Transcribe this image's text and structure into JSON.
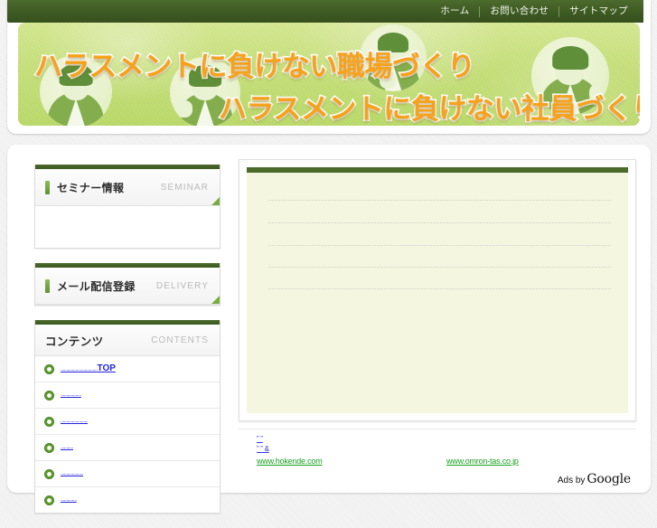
{
  "nav": {
    "items": [
      {
        "label": "ホーム",
        "name": "nav-home"
      },
      {
        "label": "お問い合わせ",
        "name": "nav-contact"
      },
      {
        "label": "サイトマップ",
        "name": "nav-sitemap"
      }
    ]
  },
  "banner": {
    "line1": "ハラスメントに負けない職場づくり",
    "line2": "ハラスメントに負けない社員づくり",
    "text_color": "#f6a21c",
    "bg_color": "#c3dd76"
  },
  "sidebar": {
    "boxes": [
      {
        "jp": "セミナー情報",
        "en": "SEMINAR",
        "name": "seminar"
      },
      {
        "jp": "メール配信登録",
        "en": "DELIVERY",
        "name": "delivery"
      }
    ],
    "contents": {
      "jp": "コンテンツ",
      "en": "CONTENTS",
      "items": [
        {
          "prefix": "................................",
          "big": "TOP",
          "suffix": ""
        },
        {
          "prefix": "..................",
          "big": "",
          "suffix": ""
        },
        {
          "prefix": "........................",
          "big": "",
          "suffix": ""
        },
        {
          "prefix": "...........",
          "big": "",
          "suffix": ""
        },
        {
          "prefix": "....................",
          "big": "",
          "suffix": ""
        },
        {
          "prefix": "..............",
          "big": "",
          "suffix": ""
        }
      ]
    }
  },
  "main": {
    "card": {
      "accent_color": "#4b6b2b",
      "bg_color": "#f4f6e0",
      "ghost_lines": 5
    }
  },
  "ads": {
    "label": "Ads by",
    "brand": "Google",
    "units": [
      {
        "title_line1": "”     ”",
        "title_line2": "”     ”  &",
        "url": "www.hokende.com",
        "url_color": "#18a020"
      },
      {
        "title_line1": "",
        "title_line2": "",
        "url": "www.omron-tas.co.jp",
        "url_color": "#18a020"
      }
    ]
  }
}
